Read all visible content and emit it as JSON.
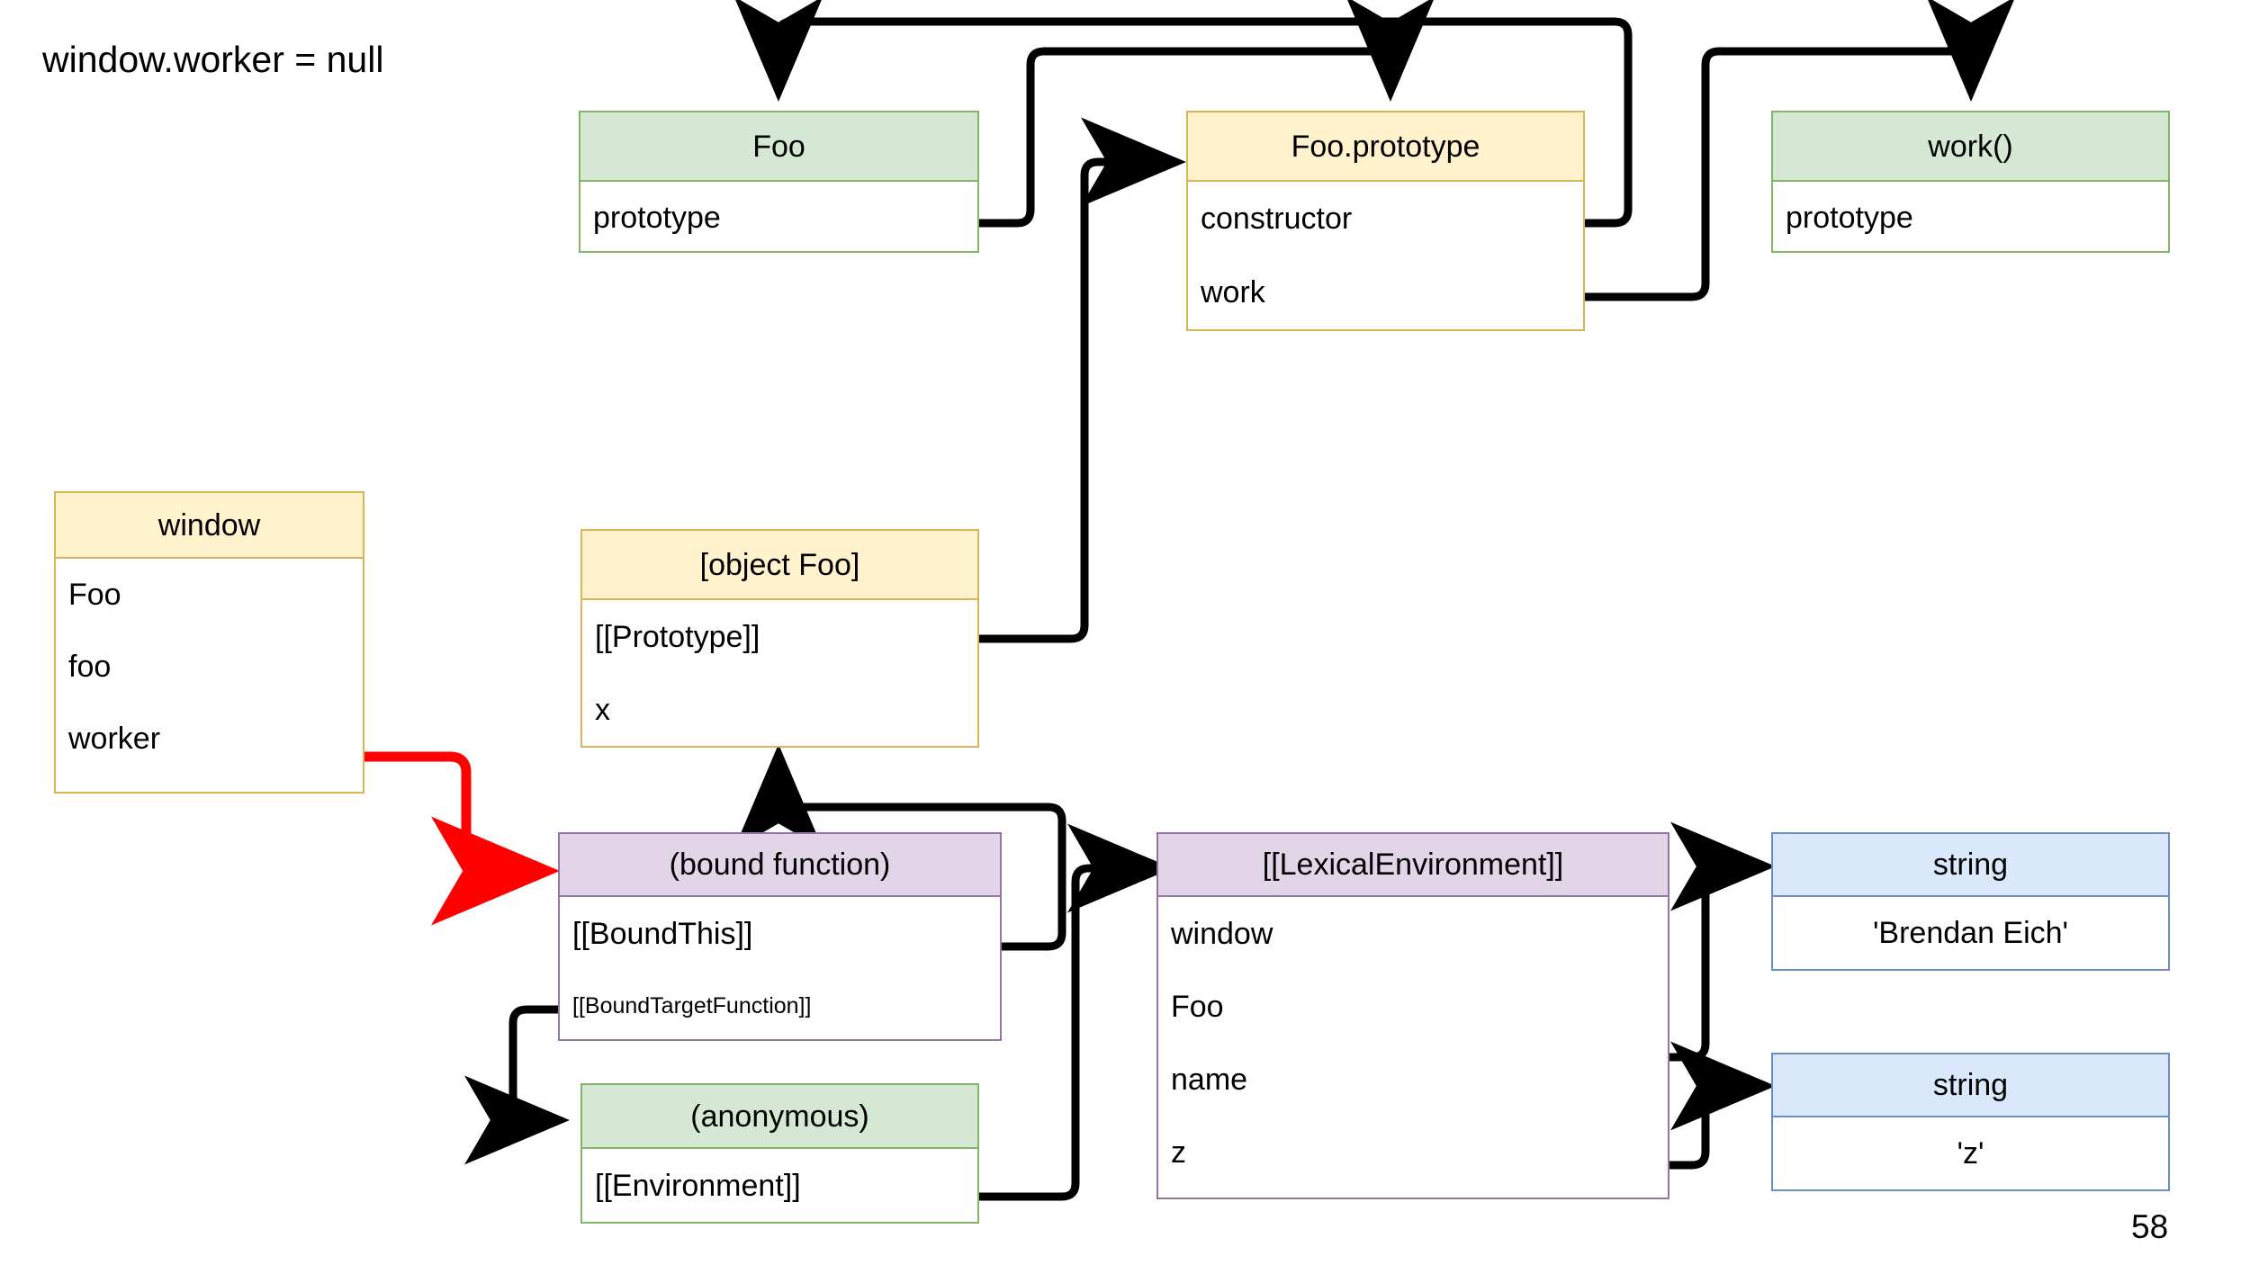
{
  "slide": {
    "title": "window.worker = null",
    "page_number": "58",
    "background": "#ffffff"
  },
  "palette": {
    "green_fill": "#d5e8d4",
    "green_stroke": "#82b366",
    "yellow_fill": "#fff2cc",
    "yellow_stroke": "#d6b656",
    "purple_fill": "#e1d5e7",
    "purple_stroke": "#9673a6",
    "blue_fill": "#dae8fc",
    "blue_stroke": "#6c8ebf",
    "edge_default": "#000000",
    "edge_highlight": "#ff0000"
  },
  "nodes": [
    {
      "id": "foo-ctor",
      "title": "Foo",
      "color": "green",
      "rows": [
        {
          "label": "prototype"
        }
      ]
    },
    {
      "id": "foo-prototype",
      "title": "Foo.prototype",
      "color": "yellow",
      "rows": [
        {
          "label": "constructor"
        },
        {
          "label": "work"
        }
      ]
    },
    {
      "id": "work-fn",
      "title": "work()",
      "color": "green",
      "rows": [
        {
          "label": "prototype"
        }
      ]
    },
    {
      "id": "window",
      "title": "window",
      "color": "yellow",
      "rows": [
        {
          "label": "Foo"
        },
        {
          "label": "foo"
        },
        {
          "label": "worker"
        }
      ]
    },
    {
      "id": "object-foo",
      "title": "[object Foo]",
      "color": "yellow",
      "rows": [
        {
          "label": "[[Prototype]]"
        },
        {
          "label": "x"
        }
      ]
    },
    {
      "id": "bound-function",
      "title": "(bound function)",
      "color": "purple",
      "rows": [
        {
          "label": "[[BoundThis]]"
        },
        {
          "label": "[[BoundTargetFunction]]"
        }
      ]
    },
    {
      "id": "anonymous",
      "title": "(anonymous)",
      "color": "green",
      "rows": [
        {
          "label": "[[Environment]]"
        }
      ]
    },
    {
      "id": "lexical-environment",
      "title": "[[LexicalEnvironment]]",
      "color": "purple",
      "rows": [
        {
          "label": "window"
        },
        {
          "label": "Foo"
        },
        {
          "label": "name"
        },
        {
          "label": "z"
        }
      ]
    },
    {
      "id": "string-brendan",
      "title": "string",
      "color": "blue",
      "rows": [
        {
          "label": "'Brendan Eich'"
        }
      ]
    },
    {
      "id": "string-z",
      "title": "string",
      "color": "blue",
      "rows": [
        {
          "label": "'z'"
        }
      ]
    }
  ],
  "edges": [
    {
      "from": "foo-prototype.constructor",
      "to": "foo-ctor.header",
      "color": "#000000"
    },
    {
      "from": "foo-ctor.prototype",
      "to": "foo-prototype.header",
      "color": "#000000"
    },
    {
      "from": "foo-prototype.work",
      "to": "work-fn.header",
      "color": "#000000"
    },
    {
      "from": "window.worker",
      "to": "bound-function.header",
      "color": "#ff0000"
    },
    {
      "from": "object-foo.[[Prototype]]",
      "to": "foo-prototype.header",
      "color": "#000000"
    },
    {
      "from": "bound-function.[[BoundThis]]",
      "to": "object-foo.bottom",
      "color": "#000000"
    },
    {
      "from": "bound-function.[[BoundTargetFunction]]",
      "to": "anonymous.header",
      "color": "#000000"
    },
    {
      "from": "anonymous.[[Environment]]",
      "to": "lexical-environment.header",
      "color": "#000000"
    },
    {
      "from": "lexical-environment.name",
      "to": "string-brendan.header",
      "color": "#000000"
    },
    {
      "from": "lexical-environment.z",
      "to": "string-z.header",
      "color": "#000000"
    }
  ]
}
